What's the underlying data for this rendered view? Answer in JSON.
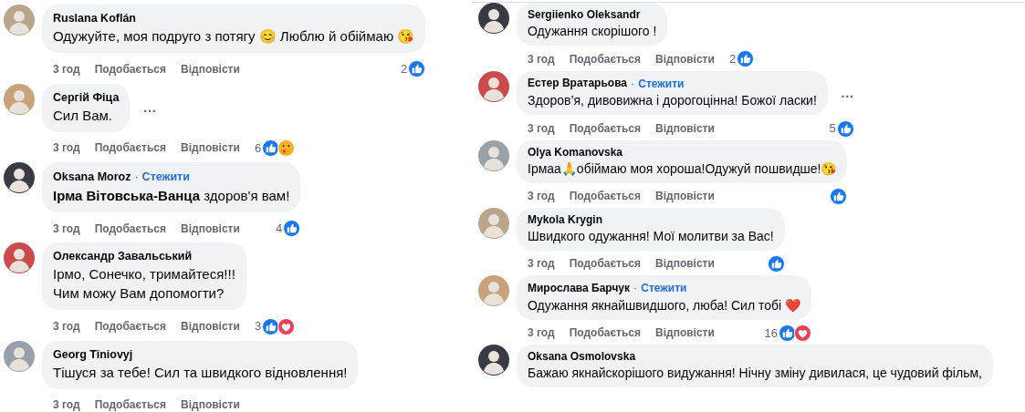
{
  "columns": [
    {
      "comments": [
        {
          "author": "Ruslana Koflán",
          "text": "Одужуйте, моя подруго з потягу 😊 Люблю й обіймаю 😘",
          "time": "3 год",
          "like": "Подобається",
          "reply": "Відповісти",
          "count": "2",
          "reactions": [
            {
              "kind": "like"
            }
          ]
        },
        {
          "author": "Сергій Фіца",
          "text": "Сил Вам.",
          "more": "…",
          "time": "3 год",
          "like": "Подобається",
          "reply": "Відповісти",
          "count": "6",
          "reactions": [
            {
              "kind": "like"
            },
            {
              "kind": "care"
            }
          ]
        },
        {
          "author": "Oksana Moroz",
          "dot": "·",
          "follow": "Стежити",
          "text": "**Ірма Вітовська-Ванца** здоров'я вам!",
          "time": "3 год",
          "like": "Подобається",
          "reply": "Відповісти",
          "count": "4",
          "reactions": [
            {
              "kind": "like"
            }
          ]
        },
        {
          "author": "Олександр Завальський",
          "text": "Ірмо, Сонечко, тримайтеся!!!\nЧим можу Вам допомогти?",
          "time": "3 год",
          "like": "Подобається",
          "reply": "Відповісти",
          "count": "3",
          "reactions": [
            {
              "kind": "like"
            },
            {
              "kind": "love"
            }
          ]
        },
        {
          "author": "Georg Tiniovyj",
          "text": "Тішуся за тебе! Сил та швидкого відновлення!",
          "time": "3 год",
          "like": "Подобається",
          "reply": "Відповісти"
        }
      ]
    },
    {
      "comments": [
        {
          "author": "Sergiienko Oleksandr",
          "text": "Одужання скорішого !",
          "time": "3 год",
          "like": "Подобається",
          "reply": "Відповісти",
          "count": "2",
          "reactions": [
            {
              "kind": "like"
            }
          ]
        },
        {
          "author": "Естер Вратарьова",
          "dot": "·",
          "follow": "Стежити",
          "text": "Здоров’я, дивовижна і дорогоцінна! Божої ласки!",
          "more": "…",
          "time": "3 год",
          "like": "Подобається",
          "reply": "Відповісти",
          "count": "5",
          "reactions": [
            {
              "kind": "like"
            }
          ]
        },
        {
          "author": "Olya Komanovska",
          "text": "Ірмаа🙏обіймаю моя хороша!Одужуй пошвидше!😘",
          "time": "3 год",
          "like": "Подобається",
          "reply": "Відповісти",
          "reactions": [
            {
              "kind": "like"
            }
          ]
        },
        {
          "author": "Mykola Krygin",
          "text": "Швидкого одужання! Мої молитви за Вас!",
          "time": "3 год",
          "like": "Подобається",
          "reply": "Відповісти",
          "reactions": [
            {
              "kind": "like"
            }
          ]
        },
        {
          "author": "Мирослава Барчук",
          "dot": "·",
          "follow": "Стежити",
          "text": "Одужання якнайшвидшого, люба! Сил тобі ❤️",
          "time": "3 год",
          "like": "Подобається",
          "reply": "Відповісти",
          "count": "16",
          "reactions": [
            {
              "kind": "like"
            },
            {
              "kind": "love"
            }
          ]
        },
        {
          "author": "Oksana Osmolovska",
          "text": "Бажаю якнайскорішого видужання! Нічну зміну дивилася, це чудовий фільм,"
        }
      ]
    }
  ]
}
